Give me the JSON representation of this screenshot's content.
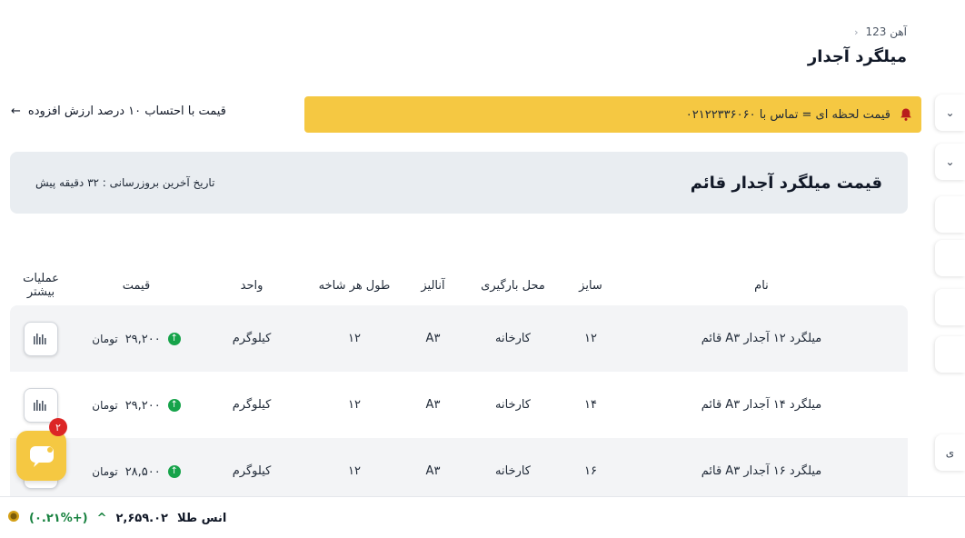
{
  "breadcrumb": {
    "parent": "آهن 123",
    "sep": "‹"
  },
  "page_title": "میلگرد آجدار",
  "notice": {
    "text": "قیمت لحظه ای = تماس با ۰۲۱۲۲۳۳۶۰۶۰"
  },
  "vat_link": {
    "text": "قیمت با احتساب ۱۰ درصد ارزش افزوده",
    "arrow": "←"
  },
  "header_card": {
    "title": "قیمت میلگرد آجدار قائم",
    "updated": "تاریخ آخرین بروزرسانی : ۳۲ دقیقه پیش"
  },
  "table": {
    "headers": [
      "نام",
      "سایز",
      "محل بارگیری",
      "آنالیز",
      "طول هر شاخه",
      "واحد",
      "قیمت",
      "عملیات بیشتر"
    ],
    "rows": [
      {
        "name": "میلگرد ۱۲ آجدار A۳ قائم",
        "size": "۱۲",
        "location": "کارخانه",
        "analysis": "A۳",
        "length": "۱۲",
        "unit": "کیلوگرم",
        "price": "۲۹,۲۰۰",
        "currency": "تومان"
      },
      {
        "name": "میلگرد ۱۴ آجدار A۳ قائم",
        "size": "۱۴",
        "location": "کارخانه",
        "analysis": "A۳",
        "length": "۱۲",
        "unit": "کیلوگرم",
        "price": "۲۹,۲۰۰",
        "currency": "تومان"
      },
      {
        "name": "میلگرد ۱۶ آجدار A۳ قائم",
        "size": "۱۶",
        "location": "کارخانه",
        "analysis": "A۳",
        "length": "۱۲",
        "unit": "کیلوگرم",
        "price": "۲۸,۵۰۰",
        "currency": "تومان"
      }
    ]
  },
  "chat": {
    "badge": "۲"
  },
  "ticker": {
    "label": "انس طلا",
    "price": "۲,۶۵۹.۰۲",
    "change": "(+۰.۲۱%)",
    "caret": "^"
  },
  "right_tabs": {
    "chevron": "⌄",
    "fragment": "ی"
  },
  "colors": {
    "accent_yellow": "#f5c842",
    "up_green": "#16a34a",
    "badge_red": "#dc2626",
    "card_bg": "#e9edf1"
  }
}
